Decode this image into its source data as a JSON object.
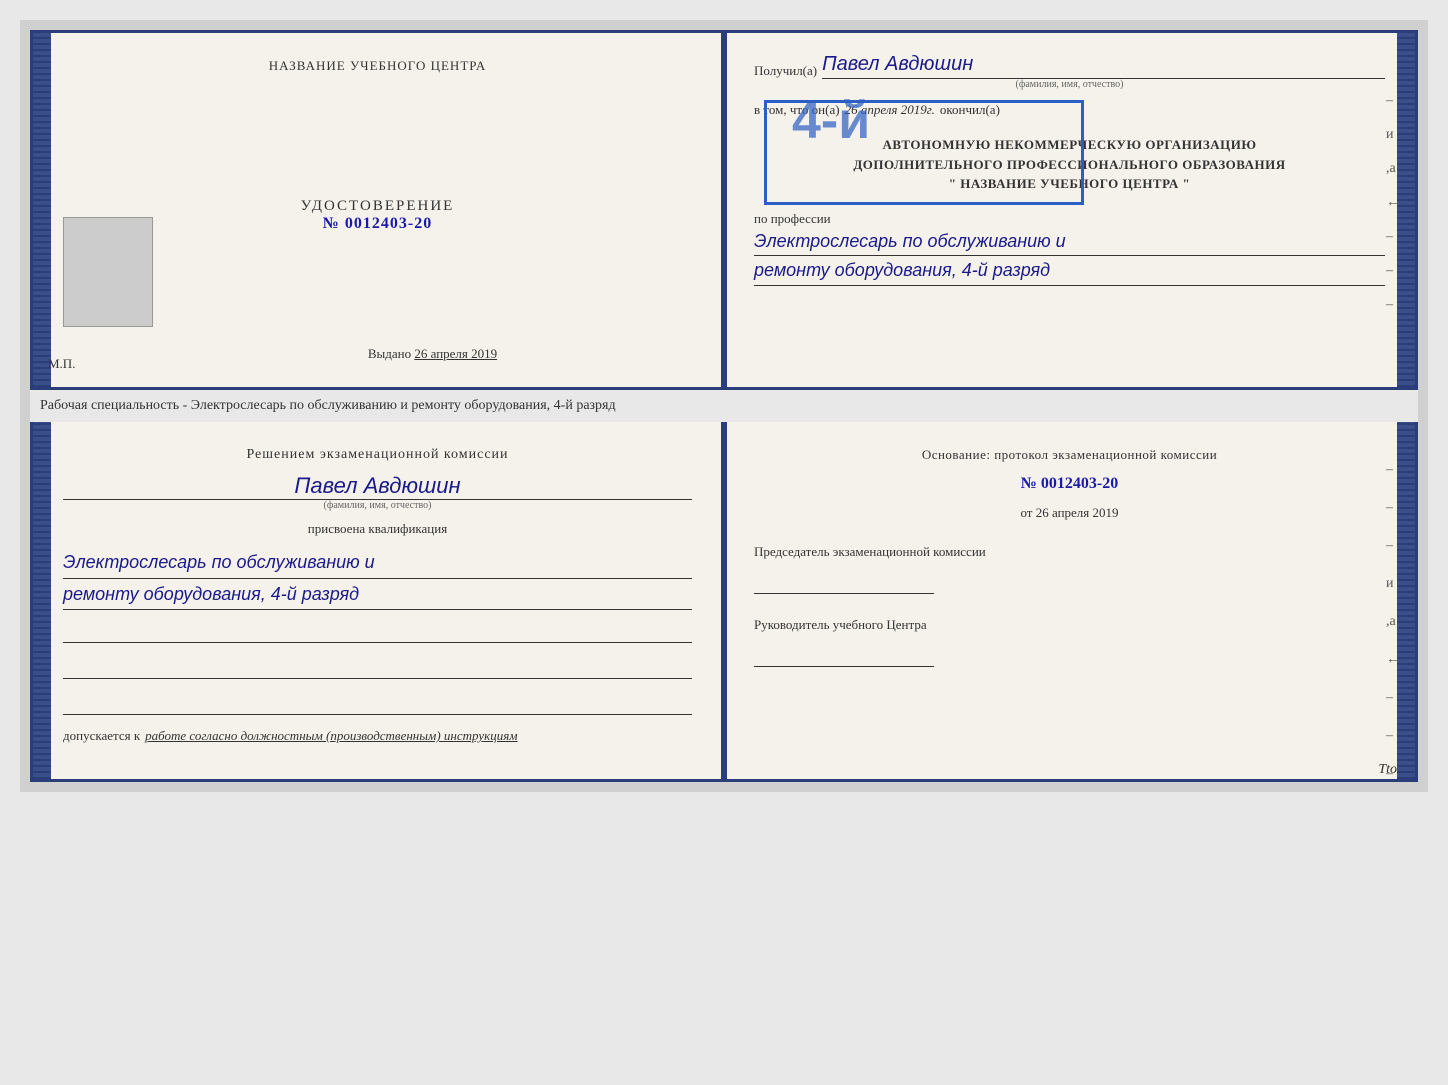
{
  "topBooklet": {
    "leftPage": {
      "centerTitle": "НАЗВАНИЕ УЧЕБНОГО ЦЕНТРА",
      "certLabel": "УДОСТОВЕРЕНИЕ",
      "certNumber": "№ 0012403-20",
      "issuedLabel": "Выдано",
      "issuedDate": "26 апреля 2019",
      "mpLabel": "М.П."
    },
    "rightPage": {
      "receivedLabel": "Получил(а)",
      "recipientName": "Павел Авдюшин",
      "fioCaption": "(фамилия, имя, отчество)",
      "inThatLabel": "в том, что он(а)",
      "completedDate": "26 апреля 2019г.",
      "completedLabel": "окончил(а)",
      "orgLine1": "АВТОНОМНУЮ НЕКОММЕРЧЕСКУЮ ОРГАНИЗАЦИЮ",
      "orgLine2": "ДОПОЛНИТЕЛЬНОГО ПРОФЕССИОНАЛЬНОГО ОБРАЗОВАНИЯ",
      "orgLine3": "\" НАЗВАНИЕ УЧЕБНОГО ЦЕНТРА \"",
      "professionLabel": "по профессии",
      "professionLine1": "Электрослесарь по обслуживанию и",
      "professionLine2": "ремонту оборудования, 4-й разряд",
      "stamp4y": "4-й"
    },
    "rightDashes": [
      "-",
      "и",
      ",а",
      "←",
      "-",
      "-",
      "-"
    ]
  },
  "betweenText": "Рабочая специальность - Электрослесарь по обслуживанию и ремонту оборудования, 4-й разряд",
  "bottomBooklet": {
    "leftPage": {
      "examCommissionTitle": "Решением экзаменационной комиссии",
      "personName": "Павел Авдюшин",
      "fioCaption": "(фамилия, имя, отчество)",
      "assignedText": "присвоена квалификация",
      "qualLine1": "Электрослесарь по обслуживанию и",
      "qualLine2": "ремонту оборудования, 4-й разряд",
      "допускаетсяLabel": "допускается к",
      "допускаетсяValue": "работе согласно должностным (производственным) инструкциям"
    },
    "rightPage": {
      "basisTitle": "Основание: протокол экзаменационной комиссии",
      "protocolNumber": "№ 0012403-20",
      "dateFromLabel": "от",
      "dateFromValue": "26 апреля 2019",
      "chairmanTitle": "Председатель экзаменационной комиссии",
      "directorTitle": "Руководитель учебного Центра"
    },
    "rightDashes": [
      "-",
      "-",
      "-",
      "и",
      ",а",
      "←",
      "-",
      "-",
      "-"
    ]
  },
  "ttoText": "Tto"
}
